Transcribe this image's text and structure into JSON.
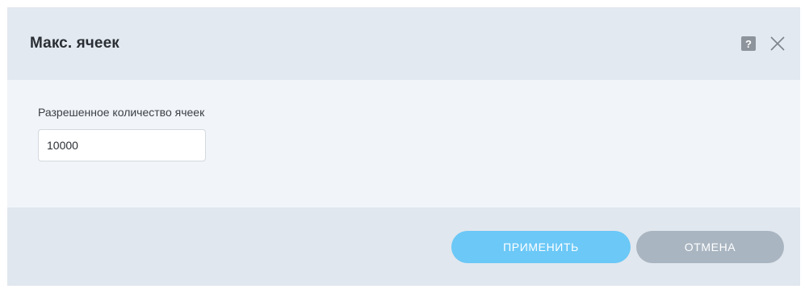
{
  "dialog": {
    "title": "Макс. ячеек",
    "help_icon": "question-icon",
    "help_glyph": "?",
    "close_icon": "close-icon"
  },
  "field": {
    "label": "Разрешенное количество ячеек",
    "value": "10000"
  },
  "buttons": {
    "apply_label": "ПРИМЕНИТЬ",
    "cancel_label": "ОТМЕНА"
  },
  "colors": {
    "apply": "#6bc8f7",
    "cancel": "#a9b5c1",
    "header_bg": "#e3e9f0",
    "body_bg": "#f1f4f8"
  }
}
